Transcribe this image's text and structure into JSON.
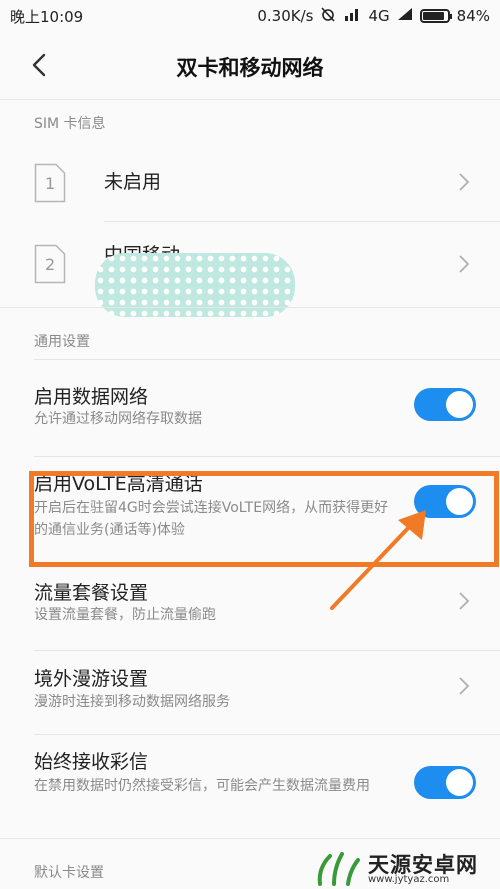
{
  "status_bar": {
    "time": "晚上10:09",
    "speed": "0.30K/s",
    "network": "4G",
    "battery": "84%"
  },
  "header": {
    "title": "双卡和移动网络"
  },
  "sim_section": {
    "label": "SIM 卡信息",
    "cards": [
      {
        "slot": "1",
        "name": "未启用"
      },
      {
        "slot": "2",
        "name": "中国移动"
      }
    ]
  },
  "general_section": {
    "label": "通用设置",
    "items": [
      {
        "title": "启用数据网络",
        "desc": "允许通过移动网络存取数据",
        "control": "toggle",
        "on": true
      },
      {
        "title": "启用VoLTE高清通话",
        "desc": "开启后在驻留4G时会尝试连接VoLTE网络，从而获得更好的通信业务(通话等)体验",
        "control": "toggle",
        "on": true
      },
      {
        "title": "流量套餐设置",
        "desc": "设置流量套餐，防止流量偷跑",
        "control": "chevron"
      },
      {
        "title": "境外漫游设置",
        "desc": "漫游时连接到移动数据网络服务",
        "control": "chevron"
      },
      {
        "title": "始终接收彩信",
        "desc": "在禁用数据时仍然接受彩信，可能会产生数据流量费用",
        "control": "toggle",
        "on": true
      }
    ]
  },
  "default_section": {
    "label": "默认卡设置"
  },
  "watermark": {
    "name": "天源安卓网",
    "url": "www.jytyaz.com"
  },
  "colors": {
    "toggle_on": "#1e8df0",
    "highlight": "#f07a25",
    "background": "#fafafa"
  }
}
